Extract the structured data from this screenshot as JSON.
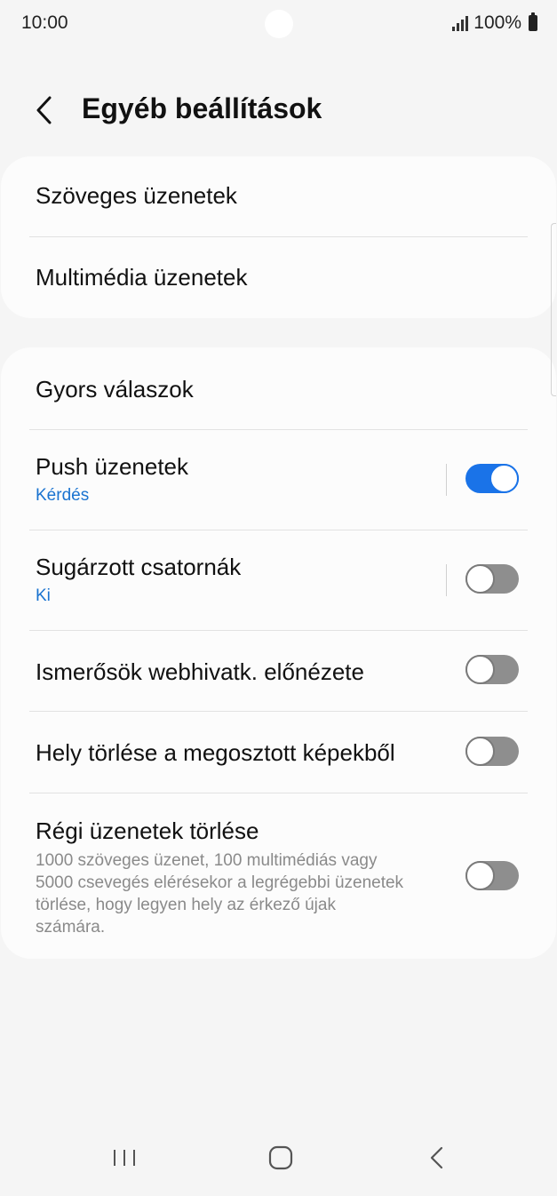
{
  "status_bar": {
    "time": "10:00",
    "battery_text": "100%"
  },
  "header": {
    "title": "Egyéb beállítások"
  },
  "group1": [
    {
      "title": "Szöveges üzenetek"
    },
    {
      "title": "Multimédia üzenetek"
    }
  ],
  "group2": {
    "quick_replies": {
      "title": "Gyors válaszok"
    },
    "push": {
      "title": "Push üzenetek",
      "subtitle": "Kérdés",
      "enabled": true
    },
    "broadcast": {
      "title": "Sugárzott csatornák",
      "subtitle": "Ki",
      "enabled": false
    },
    "link_preview": {
      "title": "Ismerősök webhivatk. előnézete",
      "enabled": false
    },
    "location_remove": {
      "title": "Hely törlése a megosztott képekből",
      "enabled": false
    },
    "delete_old": {
      "title": "Régi üzenetek törlése",
      "description": "1000 szöveges üzenet, 100 multimédiás vagy 5000 csevegés elérésekor a legrégebbi üzenetek törlése, hogy legyen hely az érkező újak számára.",
      "enabled": false
    }
  },
  "colors": {
    "accent": "#1a73e8",
    "subtitle_blue": "#1a73d0",
    "toggle_off": "#8e8e8e",
    "background": "#f5f5f5",
    "card": "#fcfcfc"
  },
  "icons": {
    "back": "chevron-left-icon",
    "nav_recents": "recents-icon",
    "nav_home": "home-icon",
    "nav_back": "nav-back-icon"
  }
}
